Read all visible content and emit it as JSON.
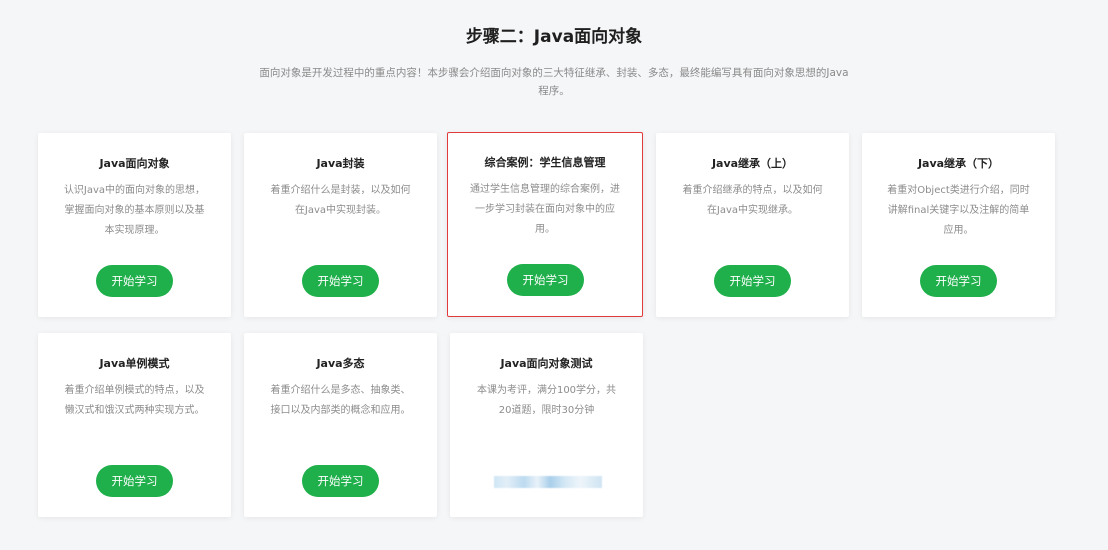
{
  "header": {
    "title": "步骤二：Java面向对象",
    "description": "面向对象是开发过程中的重点内容！本步骤会介绍面向对象的三大特征继承、封装、多态，最终能编写具有面向对象思想的Java程序。"
  },
  "cards": [
    {
      "title": "Java面向对象",
      "description": "认识Java中的面向对象的思想，掌握面向对象的基本原则以及基本实现原理。",
      "button": "开始学习"
    },
    {
      "title": "Java封装",
      "description": "着重介绍什么是封装，以及如何在Java中实现封装。",
      "button": "开始学习"
    },
    {
      "title": "综合案例：学生信息管理",
      "description": "通过学生信息管理的综合案例，进一步学习封装在面向对象中的应用。",
      "button": "开始学习"
    },
    {
      "title": "Java继承（上）",
      "description": "着重介绍继承的特点，以及如何在Java中实现继承。",
      "button": "开始学习"
    },
    {
      "title": "Java继承（下）",
      "description": "着重对Object类进行介绍，同时讲解final关键字以及注解的简单应用。",
      "button": "开始学习"
    },
    {
      "title": "Java单例模式",
      "description": "着重介绍单例模式的特点，以及懒汉式和饿汉式两种实现方式。",
      "button": "开始学习"
    },
    {
      "title": "Java多态",
      "description": "着重介绍什么是多态、抽象类、接口以及内部类的概念和应用。",
      "button": "开始学习"
    },
    {
      "title": "Java面向对象测试",
      "description": "本课为考评，满分100学分，共20道题，限时30分钟"
    }
  ]
}
